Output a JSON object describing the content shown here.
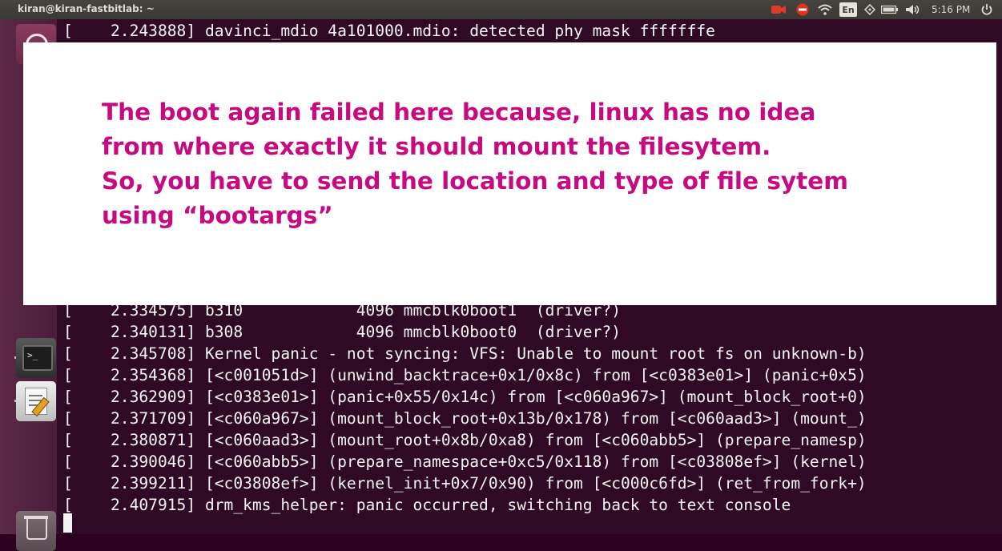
{
  "panel": {
    "window_title": "kiran@kiran-fastbitlab: ~",
    "keyboard_layout": "En",
    "clock": "5:16 PM",
    "tray_icons": [
      "camera-icon",
      "no-entry-icon",
      "wifi-icon",
      "keyboard-icon",
      "battery-icon",
      "volume-icon",
      "power-icon"
    ]
  },
  "launcher": {
    "items": [
      "dash-icon",
      "terminal-icon",
      "text-editor-icon",
      "trash-icon"
    ],
    "terminal_prompt": ">_"
  },
  "terminal": {
    "lines": [
      "[    2.243888] davinci_mdio 4a101000.mdio: detected phy mask fffffffe",
      "[    2.334575] b310            4096 mmcblk0boot1  (driver?)",
      "[    2.340131] b308            4096 mmcblk0boot0  (driver?)",
      "[    2.345708] Kernel panic - not syncing: VFS: Unable to mount root fs on unknown-b)",
      "[    2.354368] [<c001051d>] (unwind_backtrace+0x1/0x8c) from [<c0383e01>] (panic+0x5)",
      "[    2.362909] [<c0383e01>] (panic+0x55/0x14c) from [<c060a967>] (mount_block_root+0)",
      "[    2.371709] [<c060a967>] (mount_block_root+0x13b/0x178) from [<c060aad3>] (mount_)",
      "[    2.380871] [<c060aad3>] (mount_root+0x8b/0xa8) from [<c060abb5>] (prepare_namesp)",
      "[    2.390046] [<c060abb5>] (prepare_namespace+0xc5/0x118) from [<c03808ef>] (kernel)",
      "[    2.399211] [<c03808ef>] (kernel_init+0x7/0x90) from [<c000c6fd>] (ret_from_fork+)",
      "[    2.407915] drm_kms_helper: panic occurred, switching back to text console"
    ]
  },
  "overlay": {
    "lines": [
      "The boot again failed here because, linux has no idea",
      "from where exactly it should mount the filesytem.",
      "So, you have to send the location and type of file sytem",
      "using “bootargs”"
    ],
    "text_color": "#c60a80"
  },
  "colors": {
    "terminal_bg": "#300a24",
    "terminal_fg": "#f4f4f4",
    "panel_bg": "#3c3b37"
  }
}
